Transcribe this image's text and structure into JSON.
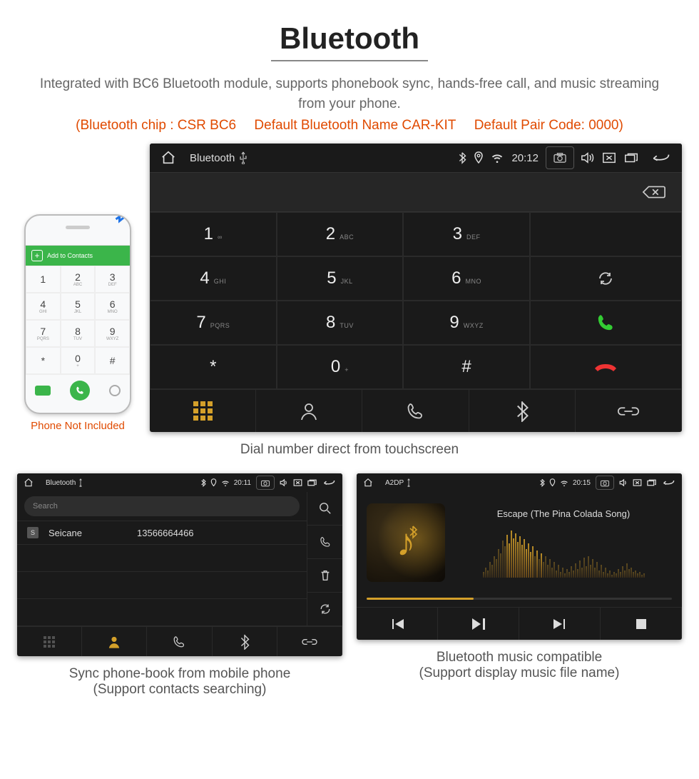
{
  "header": {
    "title": "Bluetooth",
    "desc": "Integrated with BC6 Bluetooth module, supports phonebook sync, hands-free call, and music streaming from your phone.",
    "spec_chip": "(Bluetooth chip : CSR BC6",
    "spec_name": "Default Bluetooth Name CAR-KIT",
    "spec_code": "Default Pair Code: 0000)"
  },
  "phone": {
    "bar_label": "Add to Contacts",
    "keys": [
      {
        "n": "1",
        "s": ""
      },
      {
        "n": "2",
        "s": "ABC"
      },
      {
        "n": "3",
        "s": "DEF"
      },
      {
        "n": "4",
        "s": "GHI"
      },
      {
        "n": "5",
        "s": "JKL"
      },
      {
        "n": "6",
        "s": "MNO"
      },
      {
        "n": "7",
        "s": "PQRS"
      },
      {
        "n": "8",
        "s": "TUV"
      },
      {
        "n": "9",
        "s": "WXYZ"
      },
      {
        "n": "*",
        "s": ""
      },
      {
        "n": "0",
        "s": "+"
      },
      {
        "n": "#",
        "s": ""
      }
    ],
    "not_included": "Phone Not Included"
  },
  "dialer": {
    "status_title": "Bluetooth",
    "status_time": "20:12",
    "keys": [
      {
        "n": "1",
        "s": "∞"
      },
      {
        "n": "2",
        "s": "ABC"
      },
      {
        "n": "3",
        "s": "DEF"
      },
      {
        "n": "4",
        "s": "GHI"
      },
      {
        "n": "5",
        "s": "JKL"
      },
      {
        "n": "6",
        "s": "MNO"
      },
      {
        "n": "7",
        "s": "PQRS"
      },
      {
        "n": "8",
        "s": "TUV"
      },
      {
        "n": "9",
        "s": "WXYZ"
      },
      {
        "n": "*",
        "s": ""
      },
      {
        "n": "0",
        "s": "+"
      },
      {
        "n": "#",
        "s": ""
      }
    ],
    "caption": "Dial number direct from touchscreen"
  },
  "contacts": {
    "status_title": "Bluetooth",
    "status_time": "20:11",
    "search_placeholder": "Search",
    "entry_badge": "S",
    "entry_name": "Seicane",
    "entry_number": "13566664466",
    "caption_l1": "Sync phone-book from mobile phone",
    "caption_l2": "(Support contacts searching)"
  },
  "music": {
    "status_title": "A2DP",
    "status_time": "20:15",
    "track": "Escape (The Pina Colada Song)",
    "caption_l1": "Bluetooth music compatible",
    "caption_l2": "(Support display music file name)"
  }
}
